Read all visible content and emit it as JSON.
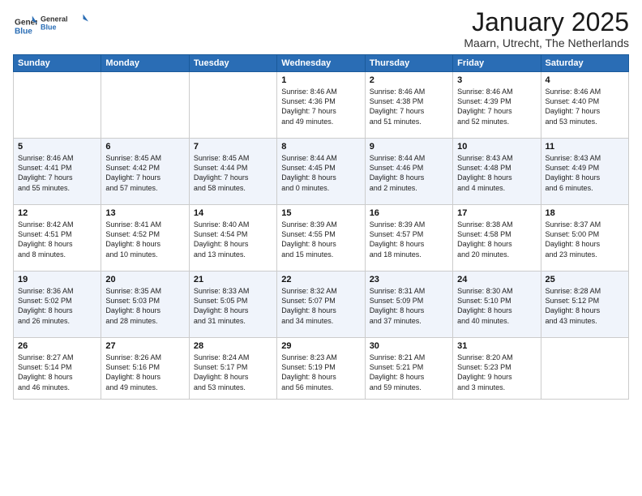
{
  "header": {
    "logo_general": "General",
    "logo_blue": "Blue",
    "month_title": "January 2025",
    "location": "Maarn, Utrecht, The Netherlands"
  },
  "weekdays": [
    "Sunday",
    "Monday",
    "Tuesday",
    "Wednesday",
    "Thursday",
    "Friday",
    "Saturday"
  ],
  "weeks": [
    [
      {
        "day": "",
        "info": ""
      },
      {
        "day": "",
        "info": ""
      },
      {
        "day": "",
        "info": ""
      },
      {
        "day": "1",
        "info": "Sunrise: 8:46 AM\nSunset: 4:36 PM\nDaylight: 7 hours\nand 49 minutes."
      },
      {
        "day": "2",
        "info": "Sunrise: 8:46 AM\nSunset: 4:38 PM\nDaylight: 7 hours\nand 51 minutes."
      },
      {
        "day": "3",
        "info": "Sunrise: 8:46 AM\nSunset: 4:39 PM\nDaylight: 7 hours\nand 52 minutes."
      },
      {
        "day": "4",
        "info": "Sunrise: 8:46 AM\nSunset: 4:40 PM\nDaylight: 7 hours\nand 53 minutes."
      }
    ],
    [
      {
        "day": "5",
        "info": "Sunrise: 8:46 AM\nSunset: 4:41 PM\nDaylight: 7 hours\nand 55 minutes."
      },
      {
        "day": "6",
        "info": "Sunrise: 8:45 AM\nSunset: 4:42 PM\nDaylight: 7 hours\nand 57 minutes."
      },
      {
        "day": "7",
        "info": "Sunrise: 8:45 AM\nSunset: 4:44 PM\nDaylight: 7 hours\nand 58 minutes."
      },
      {
        "day": "8",
        "info": "Sunrise: 8:44 AM\nSunset: 4:45 PM\nDaylight: 8 hours\nand 0 minutes."
      },
      {
        "day": "9",
        "info": "Sunrise: 8:44 AM\nSunset: 4:46 PM\nDaylight: 8 hours\nand 2 minutes."
      },
      {
        "day": "10",
        "info": "Sunrise: 8:43 AM\nSunset: 4:48 PM\nDaylight: 8 hours\nand 4 minutes."
      },
      {
        "day": "11",
        "info": "Sunrise: 8:43 AM\nSunset: 4:49 PM\nDaylight: 8 hours\nand 6 minutes."
      }
    ],
    [
      {
        "day": "12",
        "info": "Sunrise: 8:42 AM\nSunset: 4:51 PM\nDaylight: 8 hours\nand 8 minutes."
      },
      {
        "day": "13",
        "info": "Sunrise: 8:41 AM\nSunset: 4:52 PM\nDaylight: 8 hours\nand 10 minutes."
      },
      {
        "day": "14",
        "info": "Sunrise: 8:40 AM\nSunset: 4:54 PM\nDaylight: 8 hours\nand 13 minutes."
      },
      {
        "day": "15",
        "info": "Sunrise: 8:39 AM\nSunset: 4:55 PM\nDaylight: 8 hours\nand 15 minutes."
      },
      {
        "day": "16",
        "info": "Sunrise: 8:39 AM\nSunset: 4:57 PM\nDaylight: 8 hours\nand 18 minutes."
      },
      {
        "day": "17",
        "info": "Sunrise: 8:38 AM\nSunset: 4:58 PM\nDaylight: 8 hours\nand 20 minutes."
      },
      {
        "day": "18",
        "info": "Sunrise: 8:37 AM\nSunset: 5:00 PM\nDaylight: 8 hours\nand 23 minutes."
      }
    ],
    [
      {
        "day": "19",
        "info": "Sunrise: 8:36 AM\nSunset: 5:02 PM\nDaylight: 8 hours\nand 26 minutes."
      },
      {
        "day": "20",
        "info": "Sunrise: 8:35 AM\nSunset: 5:03 PM\nDaylight: 8 hours\nand 28 minutes."
      },
      {
        "day": "21",
        "info": "Sunrise: 8:33 AM\nSunset: 5:05 PM\nDaylight: 8 hours\nand 31 minutes."
      },
      {
        "day": "22",
        "info": "Sunrise: 8:32 AM\nSunset: 5:07 PM\nDaylight: 8 hours\nand 34 minutes."
      },
      {
        "day": "23",
        "info": "Sunrise: 8:31 AM\nSunset: 5:09 PM\nDaylight: 8 hours\nand 37 minutes."
      },
      {
        "day": "24",
        "info": "Sunrise: 8:30 AM\nSunset: 5:10 PM\nDaylight: 8 hours\nand 40 minutes."
      },
      {
        "day": "25",
        "info": "Sunrise: 8:28 AM\nSunset: 5:12 PM\nDaylight: 8 hours\nand 43 minutes."
      }
    ],
    [
      {
        "day": "26",
        "info": "Sunrise: 8:27 AM\nSunset: 5:14 PM\nDaylight: 8 hours\nand 46 minutes."
      },
      {
        "day": "27",
        "info": "Sunrise: 8:26 AM\nSunset: 5:16 PM\nDaylight: 8 hours\nand 49 minutes."
      },
      {
        "day": "28",
        "info": "Sunrise: 8:24 AM\nSunset: 5:17 PM\nDaylight: 8 hours\nand 53 minutes."
      },
      {
        "day": "29",
        "info": "Sunrise: 8:23 AM\nSunset: 5:19 PM\nDaylight: 8 hours\nand 56 minutes."
      },
      {
        "day": "30",
        "info": "Sunrise: 8:21 AM\nSunset: 5:21 PM\nDaylight: 8 hours\nand 59 minutes."
      },
      {
        "day": "31",
        "info": "Sunrise: 8:20 AM\nSunset: 5:23 PM\nDaylight: 9 hours\nand 3 minutes."
      },
      {
        "day": "",
        "info": ""
      }
    ]
  ]
}
